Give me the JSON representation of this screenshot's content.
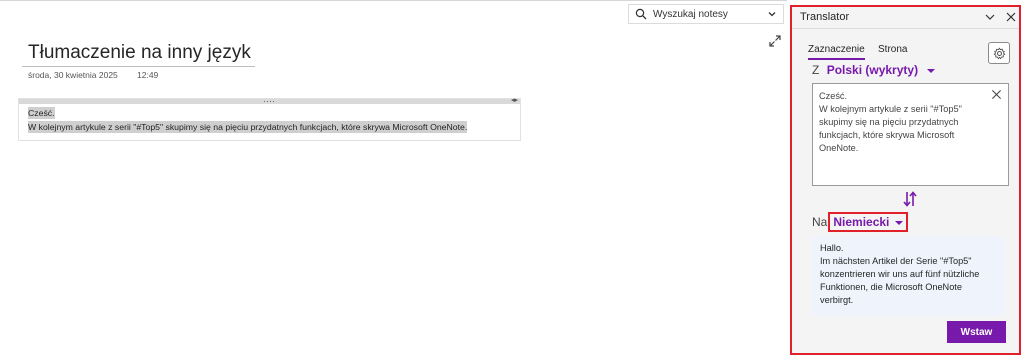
{
  "header": {
    "search_placeholder": "Wyszukaj notesy"
  },
  "page": {
    "title": "Tłumaczenie na inny język",
    "date": "środa, 30 kwietnia 2025",
    "time": "12:49",
    "lines": [
      "Cześć.",
      "W kolejnym artykule z serii \"#Top5\" skupimy się na pięciu przydatnych funkcjach, które skrywa Microsoft OneNote."
    ]
  },
  "translator": {
    "title": "Translator",
    "tabs": [
      {
        "label": "Zaznaczenie",
        "selected": true
      },
      {
        "label": "Strona",
        "selected": false
      }
    ],
    "from_prefix": "Z",
    "from_language": "Polski (wykryty)",
    "source_text": "Cześć.\nW kolejnym artykule z serii \"#Top5\" skupimy się na pięciu przydatnych funkcjach, które skrywa Microsoft OneNote.",
    "to_prefix": "Na",
    "to_language": "Niemiecki",
    "target_text": "Hallo.\nIm nächsten Artikel der Serie \"#Top5\" konzentrieren wir uns auf fünf nützliche Funktionen, die Microsoft OneNote verbirgt.",
    "insert_label": "Wstaw"
  },
  "colors": {
    "accent": "#7719aa",
    "highlight": "#e0202a"
  },
  "icons": {
    "search": "search-icon",
    "dropdown": "chevron-down-icon",
    "expand": "expand-icon",
    "minimize": "chevron-down-icon",
    "close": "close-icon",
    "settings": "gear-icon",
    "clear": "close-icon",
    "swap": "swap-icon"
  }
}
